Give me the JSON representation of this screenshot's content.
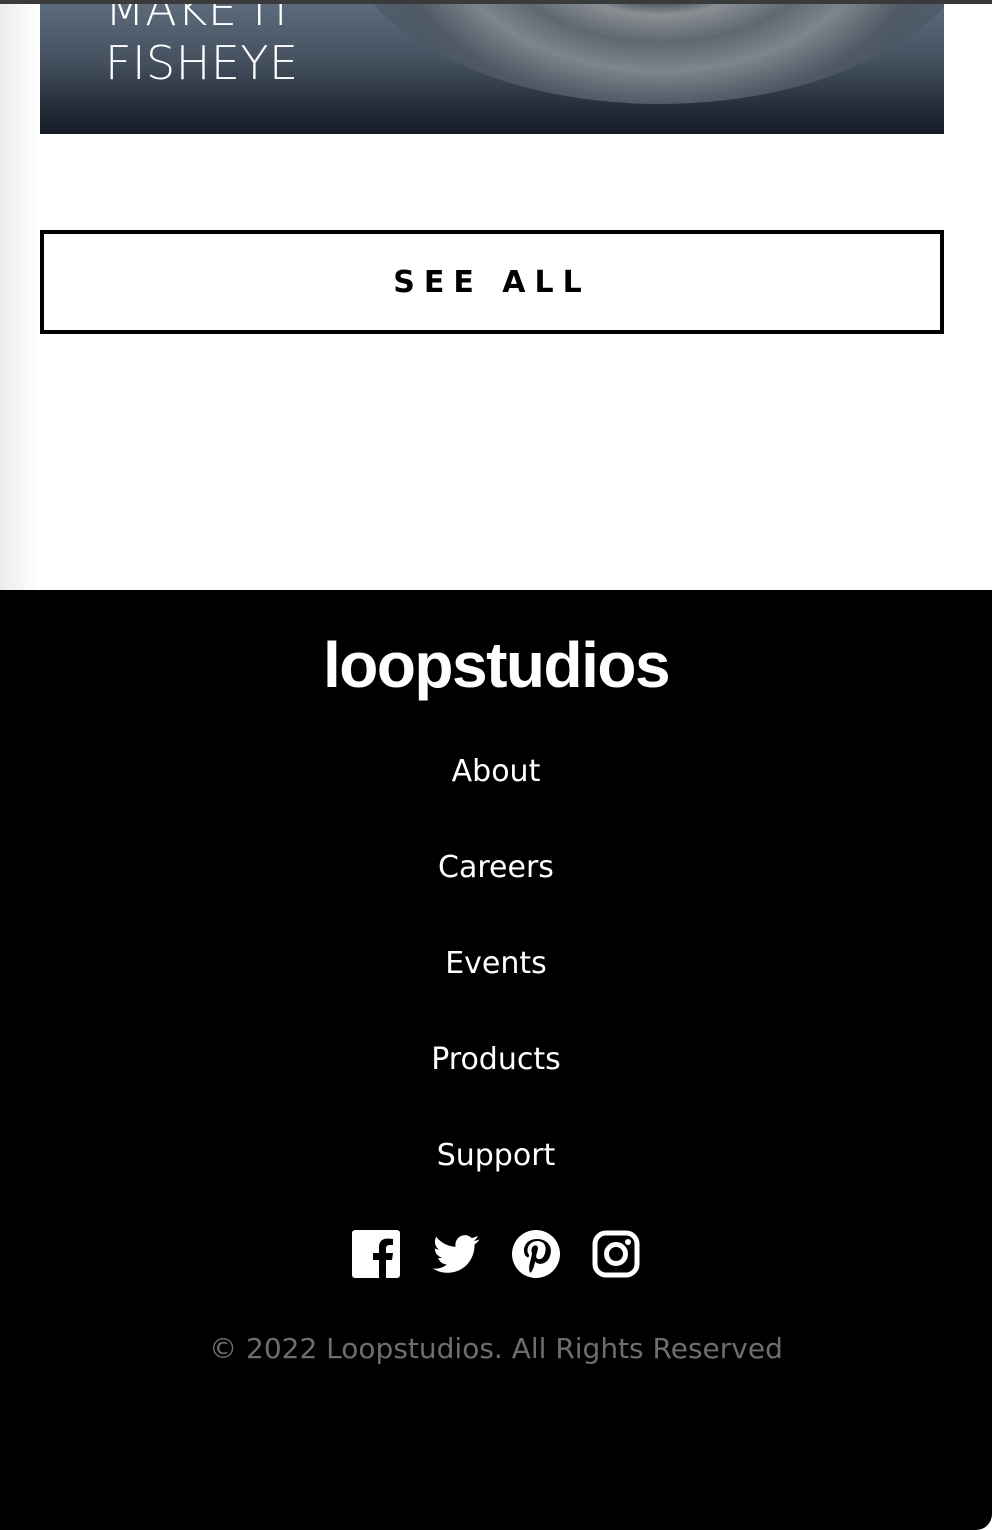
{
  "hero_card": {
    "title": "MAKE IT\nFISHEYE"
  },
  "see_all": {
    "label": "SEE ALL"
  },
  "footer": {
    "logo": "loopstudios",
    "nav": [
      {
        "label": "About"
      },
      {
        "label": "Careers"
      },
      {
        "label": "Events"
      },
      {
        "label": "Products"
      },
      {
        "label": "Support"
      }
    ],
    "social_icons": [
      "facebook-icon",
      "twitter-icon",
      "pinterest-icon",
      "instagram-icon"
    ],
    "copyright": "© 2022 Loopstudios. All Rights Reserved"
  },
  "colors": {
    "background": "#ffffff",
    "footer_background": "#000000",
    "footer_text": "#ffffff",
    "copyright_text": "#6e6e6e"
  }
}
